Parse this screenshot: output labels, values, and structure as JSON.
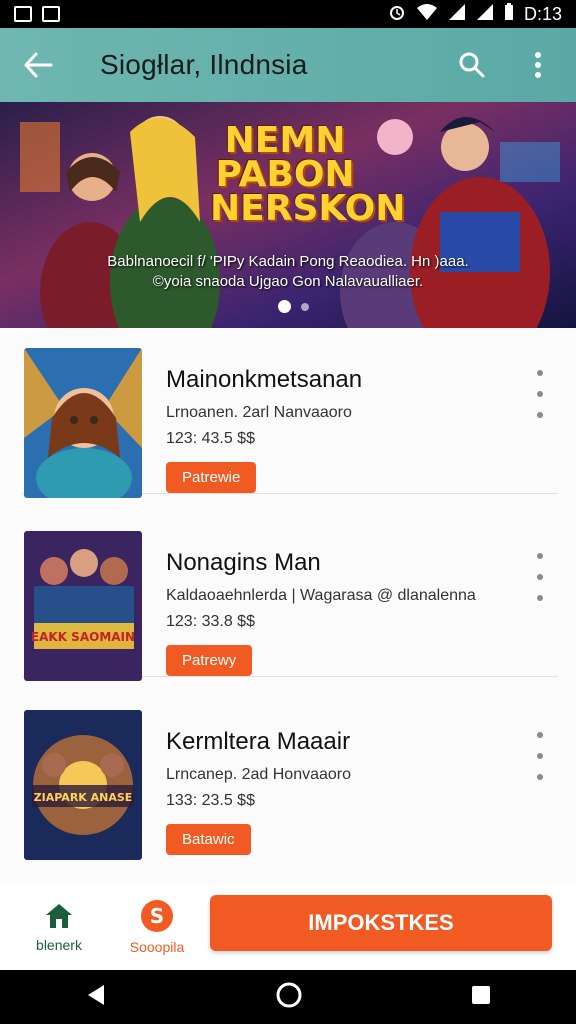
{
  "status_bar": {
    "time": "D:13"
  },
  "app_bar": {
    "title": "Siogłlar, Ilndnsia"
  },
  "banner": {
    "title_lines": [
      "NEMN",
      "PABON",
      "NERSKON"
    ],
    "caption_line1": "Bablnanoecil f/ 'PIPy Kadain Pong Reaodiea. Hn )aaa.",
    "caption_line2": "©yoia snaoda Ujgao Gon Nalavaualliaer."
  },
  "items": [
    {
      "name": "Mainonkmetsanan",
      "subtitle": "Lrnoanen. 2arl Nanvaaoro",
      "price": "123: 43.5 $$",
      "cta": "Patrewie"
    },
    {
      "name": "Nonagins Man",
      "subtitle": "Kaldaoaehnlerda | Wagarasa @ dlanalenna",
      "price": "123: 33.8 $$",
      "cta": "Patrewy"
    },
    {
      "name": "Kermltera Maaair",
      "subtitle": "Lrncanep. 2ad Honvaaoro",
      "price": "133: 23.5 $$",
      "cta": "Batawic"
    }
  ],
  "bottom_nav": {
    "home_label": "blenerk",
    "s_label": "Sooopila",
    "primary_label": "IMPOKSTKES"
  },
  "thumb_texts": {
    "item2": "EAKK SAOMAIN",
    "item3": "ZIAPARK ANASE"
  },
  "colors": {
    "accent": "#f15a22",
    "appbar": "#5aa9a6",
    "home": "#1a5e3a"
  }
}
